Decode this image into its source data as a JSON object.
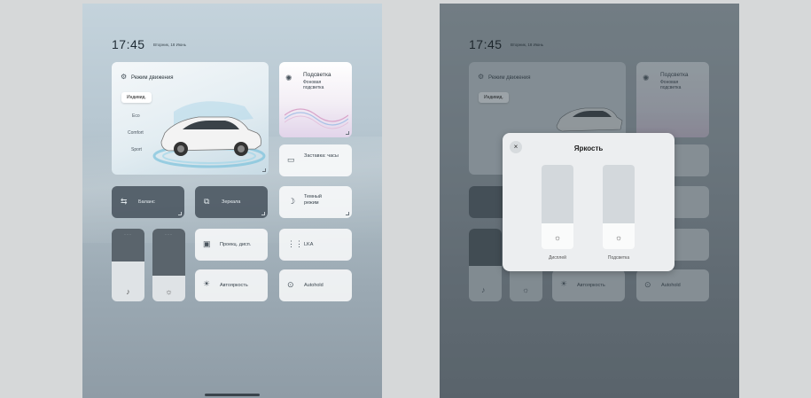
{
  "left": {
    "time": "17:45",
    "date": "Вторник, 18 Июнь",
    "drive_mode": {
      "title": "Режим движения",
      "options": [
        "Индивид.",
        "Eco",
        "Comfort",
        "Sport"
      ],
      "selected": "Индивид."
    },
    "backlight": {
      "title": "Подсветка",
      "sub": "Фоновая подсветка"
    },
    "screensaver": {
      "label": "Заставка: часы"
    },
    "balance": {
      "label": "Баланс"
    },
    "mirrors": {
      "label": "Зеркала"
    },
    "dark_mode": {
      "label": "Темный режим"
    },
    "projection": {
      "label": "Проекц. дисп."
    },
    "lka": {
      "label": "LKA"
    },
    "auto_hold": {
      "label": "Autohold"
    },
    "auto_brightness": {
      "label": "Автояркость"
    },
    "slider_volume_level": 0.55,
    "slider_brightness_level": 0.35
  },
  "right": {
    "time": "17:45",
    "date": "Вторник, 18 Июнь",
    "drive_mode_title": "Режим движения",
    "drive_chip": "Индивид.",
    "backlight": {
      "title": "Подсветка",
      "sub": "Фоновая подсветка"
    },
    "auto_brightness": {
      "label": "Автояркость"
    },
    "auto_hold": {
      "label": "Autohold"
    },
    "modal": {
      "title": "Яркость",
      "close": "×",
      "left_label": "Дисплей",
      "right_label": "Подсветка",
      "left_level": 0.22,
      "right_level": 0.22
    }
  }
}
